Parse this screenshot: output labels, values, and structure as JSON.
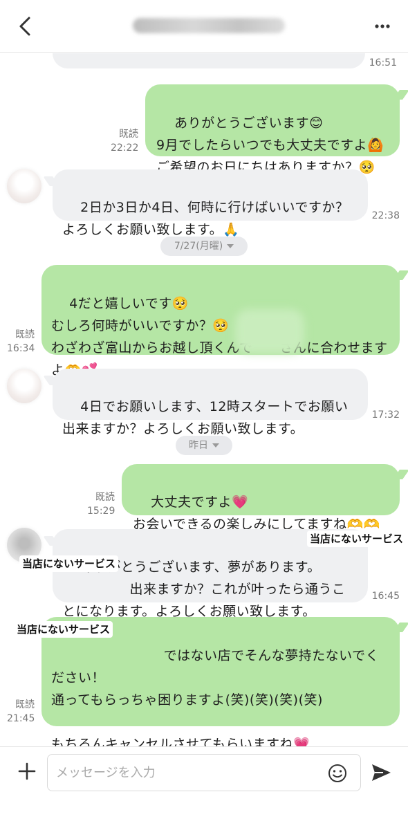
{
  "header": {
    "title": "",
    "back_icon": "chevron-left-icon",
    "more_icon": "ellipsis-icon"
  },
  "messages": [
    {
      "id": "m0",
      "side": "in",
      "text": "",
      "time": "16:51"
    },
    {
      "id": "m1",
      "side": "out",
      "text": "ありがとうございます😊\n9月でしたらいつでも大丈夫ですよ🙆\nご希望のお日にちはありますか？🥺",
      "read": "既読",
      "time": "22:22"
    },
    {
      "id": "m2",
      "side": "in",
      "text": "2日か3日か4日、何時に行けばいいですか？よろしくお願い致します。🙏",
      "time": "22:38"
    },
    {
      "id": "m3",
      "side": "out",
      "text": "4だと嬉しいです🥺\nむしろ何時がいいですか？🥺\nわざわざ富山からお越し頂くんで　　さんに合わせますよ🫶💕",
      "read": "既読",
      "time": "16:34"
    },
    {
      "id": "m4",
      "side": "in",
      "text": "4日でお願いします、12時スタートでお願い出来ますか？よろしくお願い致します。",
      "time": "17:32"
    },
    {
      "id": "m5",
      "side": "out",
      "text": "大丈夫ですよ💗\nお会いできるの楽しみにしてますね🫶🫶",
      "read": "既読",
      "time": "15:29"
    },
    {
      "id": "m6",
      "side": "in",
      "text": "ありがとうございます、夢があります。\n　　　　　出来ますか？これが叶ったら通うことになります。よろしくお願い致します。",
      "time": "16:45"
    },
    {
      "id": "m7",
      "side": "out",
      "text": "　　　　　　　ではない店でそんな夢持たないでください！\n通ってもらっちゃ困りますよ(笑)(笑)(笑)(笑)\n\nもちろんキャンセルさせてもらいますね💗",
      "read": "既読",
      "time": "21:45"
    }
  ],
  "date_separators": [
    {
      "label": "7/27(月曜)"
    },
    {
      "label": "昨日"
    }
  ],
  "overlay_labels": [
    "当店にないサービス",
    "当店にないサービス",
    "当店にないサービス"
  ],
  "input": {
    "placeholder": "メッセージを入力",
    "value": ""
  },
  "colors": {
    "outgoing_bubble": "#b5e6a5",
    "incoming_bubble": "#eff0f2",
    "meta_text": "#777777"
  }
}
